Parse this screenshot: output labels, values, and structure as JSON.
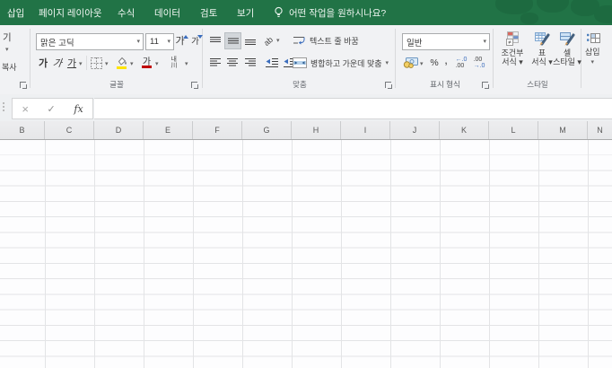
{
  "colors": {
    "accent_green": "#217346",
    "fill_yellow": "#ffe400",
    "font_red": "#c00000",
    "accent_blue": "#3b6dbd"
  },
  "ribbon": {
    "tabs": [
      {
        "name": "tab-insert",
        "label": "삽입"
      },
      {
        "name": "tab-page-layout",
        "label": "페이지 레이아웃"
      },
      {
        "name": "tab-formulas",
        "label": "수식"
      },
      {
        "name": "tab-data",
        "label": "데이터"
      },
      {
        "name": "tab-review",
        "label": "검토"
      },
      {
        "name": "tab-view",
        "label": "보기"
      }
    ],
    "tell_me": "어떤 작업을 원하시나요?",
    "clipboard": {
      "paste_fragment": "기",
      "copy_label": "복사"
    },
    "font_group": {
      "label": "글꼴",
      "font_name": "맑은 고딕",
      "font_size": "11",
      "grow_font": "가",
      "shrink_font": "가",
      "bold": "가",
      "italic": "가",
      "underline": "가",
      "font_color_glyph": "가",
      "phonetic_top": "내",
      "phonetic_bottom": "川"
    },
    "alignment_group": {
      "label": "맞춤",
      "orientation_glyph": "ab",
      "wrap_text": "텍스트 줄 바꿈",
      "merge_center": "병합하고 가운데 맞춤"
    },
    "number_group": {
      "label": "표시 형식",
      "format_selected": "일반",
      "percent": "%",
      "comma": ",",
      "inc_decimal_top": "←.0",
      "inc_decimal_bottom": ".00",
      "dec_decimal_top": ".00",
      "dec_decimal_bottom": "→.0"
    },
    "styles_group": {
      "label": "스타일",
      "buttons": [
        {
          "line1": "조건부",
          "line2": "서식 ▾"
        },
        {
          "line1": "표",
          "line2": "서식 ▾"
        },
        {
          "line1": "셀",
          "line2": "스타일 ▾"
        }
      ]
    },
    "cells_group": {
      "insert_label": "삽입"
    }
  },
  "ui": {
    "dropdown": "▾",
    "not_equal": "≠"
  },
  "formula_bar": {
    "cancel_glyph": "×",
    "enter_glyph": "✓",
    "fx_glyph": "fx",
    "value": ""
  },
  "grid": {
    "columns": [
      "B",
      "C",
      "D",
      "E",
      "F",
      "G",
      "H",
      "I",
      "J",
      "K",
      "L",
      "M",
      "N"
    ]
  }
}
